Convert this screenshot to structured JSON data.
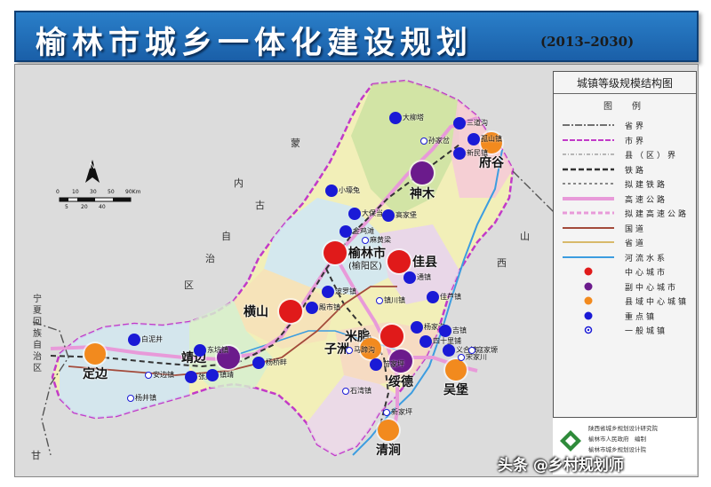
{
  "title": "榆林市城乡一体化建设规划",
  "years": "(2013–2030)",
  "map_title": "城镇等级规模结构图",
  "legend_header": "图　例",
  "legend": [
    {
      "label": "省界",
      "style": "border-prov"
    },
    {
      "label": "市界",
      "style": "border-city"
    },
    {
      "label": "县（区）界",
      "style": "border-county"
    },
    {
      "label": "铁路",
      "style": "rail"
    },
    {
      "label": "拟建铁路",
      "style": "rail-plan"
    },
    {
      "label": "高速公路",
      "style": "expressway"
    },
    {
      "label": "拟建高速公路",
      "style": "expressway-plan"
    },
    {
      "label": "国道",
      "style": "national"
    },
    {
      "label": "省道",
      "style": "provincial"
    },
    {
      "label": "河流水系",
      "style": "river"
    },
    {
      "label": "中心城市",
      "style": "dot",
      "color": "#e01a1a"
    },
    {
      "label": "副中心城市",
      "style": "dot",
      "color": "#6b1b8c"
    },
    {
      "label": "县域中心城镇",
      "style": "dot",
      "color": "#f28a1e"
    },
    {
      "label": "重点镇",
      "style": "dot",
      "color": "#1a1ad6"
    },
    {
      "label": "一般城镇",
      "style": "ring",
      "color": "#1a1ad6"
    }
  ],
  "scale_labels": [
    "0",
    "10",
    "30",
    "50",
    "90Km",
    "5",
    "20",
    "40"
  ],
  "institute": [
    "陕西省城乡规划设计研究院",
    "榆林市人民政府　编制",
    "榆林市城乡规划设计院"
  ],
  "watermark": "头条 @乡村规划师",
  "colors": {
    "center": "#e01a1a",
    "sub_center": "#6b1b8c",
    "county": "#f28a1e",
    "key": "#1a1ad6",
    "title_bg": "#1f6fbf"
  },
  "cities": [
    {
      "name": "榆林市",
      "sub": "(榆阳区)",
      "level": "center",
      "label_size": "big"
    },
    {
      "name": "神木",
      "level": "sub_center",
      "label_size": "big"
    },
    {
      "name": "府谷",
      "level": "county",
      "label_size": "big"
    },
    {
      "name": "佳县",
      "level": "center",
      "label_size": "big"
    },
    {
      "name": "横山",
      "level": "center",
      "label_size": "big"
    },
    {
      "name": "米脂",
      "level": "center",
      "label_size": "big"
    },
    {
      "name": "靖边",
      "level": "sub_center",
      "label_size": "big"
    },
    {
      "name": "定边",
      "level": "county",
      "label_size": "big"
    },
    {
      "name": "子洲",
      "level": "county",
      "label_size": "big"
    },
    {
      "name": "绥德",
      "level": "sub_center",
      "label_size": "big"
    },
    {
      "name": "吴堡",
      "level": "county",
      "label_size": "big"
    },
    {
      "name": "清涧",
      "level": "county",
      "label_size": "big"
    }
  ],
  "towns": [
    "大柳塔",
    "三道沟",
    "孙家岔",
    "孤山镇",
    "新民镇",
    "小壕兔",
    "大保当",
    "高家堡",
    "金鸡滩",
    "麻黄梁",
    "通镇",
    "佳芦镇",
    "波罗镇",
    "殿市镇",
    "镇川镇",
    "杨家沟",
    "吉镇",
    "四十里铺",
    "义合镇",
    "马蹄沟",
    "苗家坪",
    "宋家川",
    "寇家塬",
    "白泥井",
    "东坑镇",
    "杨桥畔",
    "安边镇",
    "张渠",
    "镇靖",
    "杨井镇",
    "新家坪",
    "石湾镇"
  ],
  "place_labels": [
    "蒙",
    "内",
    "古",
    "自",
    "治",
    "区",
    "山",
    "西",
    "宁夏回族自治区",
    "甘"
  ]
}
